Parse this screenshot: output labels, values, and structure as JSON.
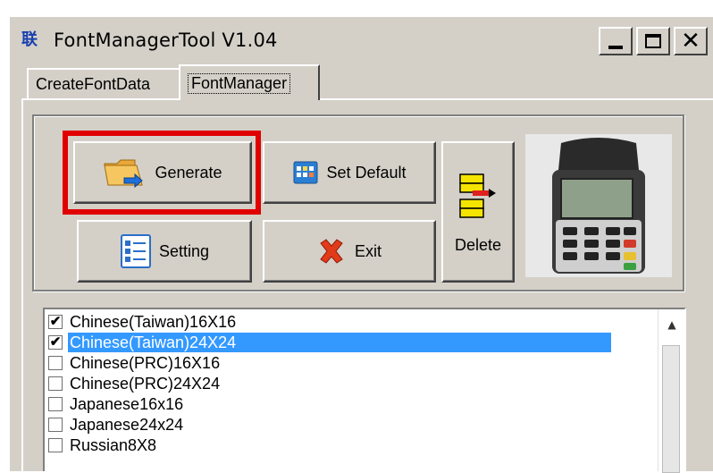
{
  "window": {
    "title": "FontManagerTool V1.04",
    "app_icon_text": "联",
    "caption_buttons": {
      "minimize": "minimize",
      "maximize": "maximize",
      "close": "✕"
    }
  },
  "tabs": [
    {
      "label": "CreateFontData",
      "active": false
    },
    {
      "label": "FontManager",
      "active": true
    }
  ],
  "toolbar": {
    "generate_label": "Generate",
    "set_default_label": "Set Default",
    "setting_label": "Setting",
    "exit_label": "Exit",
    "delete_label": "Delete"
  },
  "font_list": {
    "items": [
      {
        "label": "Chinese(Taiwan)16X16",
        "checked": true,
        "selected": false
      },
      {
        "label": "Chinese(Taiwan)24X24",
        "checked": true,
        "selected": true
      },
      {
        "label": "Chinese(PRC)16X16",
        "checked": false,
        "selected": false
      },
      {
        "label": "Chinese(PRC)24X24",
        "checked": false,
        "selected": false
      },
      {
        "label": "Japanese16x16",
        "checked": false,
        "selected": false
      },
      {
        "label": "Japanese24x24",
        "checked": false,
        "selected": false
      },
      {
        "label": "Russian8X8",
        "checked": false,
        "selected": false
      }
    ]
  },
  "colors": {
    "highlight": "#e00000",
    "selection": "#3399ff",
    "face": "#d4d0c8"
  },
  "icons": {
    "generate": "folder-arrow-icon",
    "set_default": "calendar-grid-icon",
    "setting": "settings-list-icon",
    "exit": "red-x-icon",
    "delete": "transfer-arrow-icon",
    "device": "payment-terminal-image"
  }
}
